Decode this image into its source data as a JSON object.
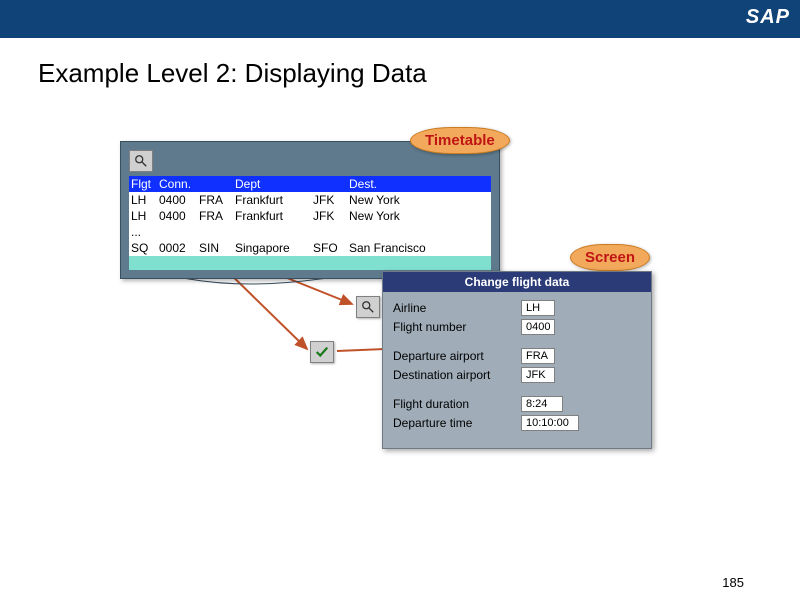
{
  "header": {
    "logo_text": "SAP",
    "title": "Example Level 2: Displaying Data"
  },
  "tags": {
    "timetable": "Timetable",
    "screen": "Screen"
  },
  "timetable": {
    "columns": {
      "flgt": "Flgt",
      "conn": "Conn.",
      "dept": "Dept",
      "dest": "Dest."
    },
    "rows": [
      {
        "flgt": "LH",
        "conn": "0400",
        "dcode": "FRA",
        "dept": "Frankfurt",
        "acode": "JFK",
        "dest": "New York"
      },
      {
        "flgt": "LH",
        "conn": "0400",
        "dcode": "FRA",
        "dept": "Frankfurt",
        "acode": "JFK",
        "dest": "New York"
      }
    ],
    "ellipsis": "...",
    "last_row": {
      "flgt": "SQ",
      "conn": "0002",
      "dcode": "SIN",
      "dept": "Singapore",
      "acode": "SFO",
      "dest": "San Francisco"
    }
  },
  "change_panel": {
    "title": "Change flight data",
    "airline_label": "Airline",
    "airline_value": "LH",
    "flightno_label": "Flight number",
    "flightno_value": "0400",
    "depap_label": "Departure airport",
    "depap_value": "FRA",
    "destap_label": "Destination airport",
    "destap_value": "JFK",
    "duration_label": "Flight duration",
    "duration_value": "8:24",
    "deptime_label": "Departure time",
    "deptime_value": "10:10:00"
  },
  "page_number": "185"
}
